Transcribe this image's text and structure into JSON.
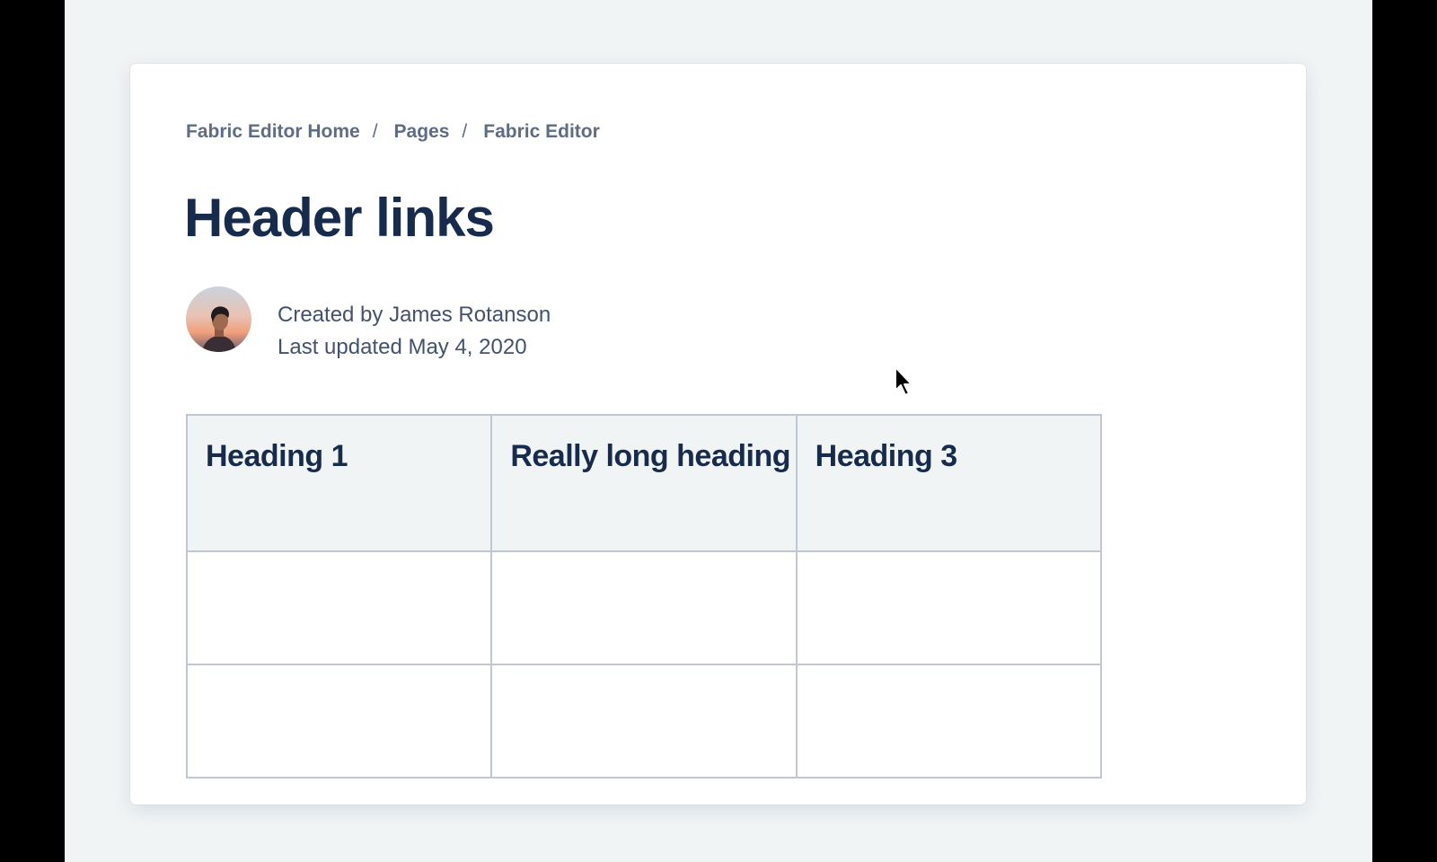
{
  "breadcrumb": {
    "items": [
      "Fabric Editor Home",
      "Pages",
      "Fabric Editor"
    ],
    "separator": "/"
  },
  "page": {
    "title": "Header links"
  },
  "author": {
    "created_by": "Created by James Rotanson",
    "last_updated": "Last updated May 4, 2020"
  },
  "table": {
    "headers": [
      "Heading 1",
      "Really long heading",
      "Heading 3"
    ],
    "rows": [
      [
        "",
        "",
        ""
      ],
      [
        "",
        "",
        ""
      ]
    ]
  },
  "colors": {
    "page_background": "#f0f4f5",
    "card_background": "#ffffff",
    "title_text": "#172b4d",
    "secondary_text": "#5e6c84",
    "table_border": "#c1c7d0",
    "header_cell_background": "#f0f4f5"
  }
}
